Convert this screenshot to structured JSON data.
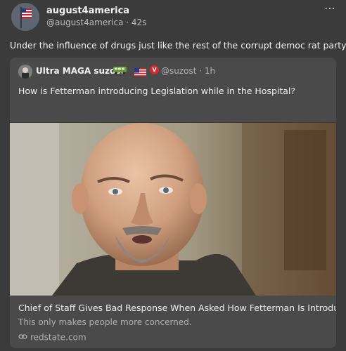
{
  "post": {
    "display_name": "august4america",
    "meta": "@august4america · 42s",
    "text": "Under the influence of drugs just like the rest of the corrupt democ rat party",
    "more_icon": "⋯"
  },
  "quote": {
    "display_name": "Ultra MAGA suzost",
    "meta": "@suzost · 1h",
    "text": "How is Fetterman introducing Legislation while in the Hospital?",
    "verified_label": "V"
  },
  "card": {
    "title": "Chief of Staff Gives Bad Response When Asked How Fetterman Is Introducing ...",
    "description": "This only makes people more concerned.",
    "domain": "redstate.com"
  },
  "colors": {
    "background": "#3b3b3b",
    "quote_background": "#4a4a4a",
    "verify_badge": "#d8262f"
  }
}
